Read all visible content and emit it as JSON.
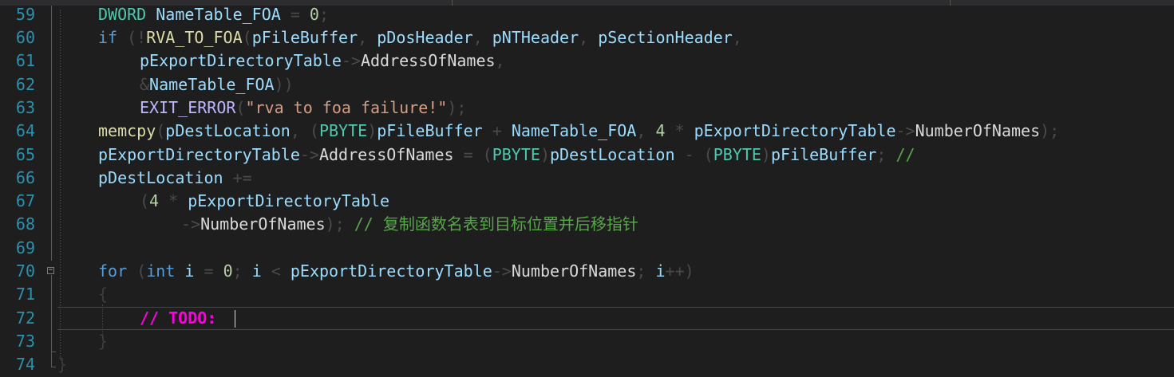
{
  "top_tabs": [
    "",
    "",
    ""
  ],
  "line_numbers": [
    "59",
    "60",
    "61",
    "62",
    "63",
    "64",
    "65",
    "66",
    "67",
    "68",
    "69",
    "70",
    "71",
    "72",
    "73",
    "74"
  ],
  "code": {
    "l59": {
      "t1": "DWORD",
      "t2": " NameTable_FOA",
      "t3": " = ",
      "t4": "0",
      "t5": ";"
    },
    "l60": {
      "t1": "if",
      "t2": " (!",
      "t3": "RVA_TO_FOA",
      "t4": "(",
      "t5": "pFileBuffer",
      "t6": ", ",
      "t7": "pDosHeader",
      "t8": ", ",
      "t9": "pNTHeader",
      "t10": ", ",
      "t11": "pSectionHeader",
      "t12": ","
    },
    "l61": {
      "t1": "pExportDirectoryTable",
      "t2": "->",
      "t3": "AddressOfNames",
      "t4": ","
    },
    "l62": {
      "t1": "&",
      "t2": "NameTable_FOA",
      "t3": "))"
    },
    "l63": {
      "t1": "EXIT_ERROR",
      "t2": "(",
      "t3": "\"rva to foa failure!\"",
      "t4": ");"
    },
    "l64": {
      "t1": "memcpy",
      "t2": "(",
      "t3": "pDestLocation",
      "t4": ", (",
      "t5": "PBYTE",
      "t6": ")",
      "t7": "pFileBuffer",
      "t8": " + ",
      "t9": "NameTable_FOA",
      "t10": ", ",
      "t11": "4",
      "t12": " * ",
      "t13": "pExportDirectoryTable",
      "t14": "->",
      "t15": "NumberOfNames",
      "t16": ");"
    },
    "l65": {
      "t1": "pExportDirectoryTable",
      "t2": "->",
      "t3": "AddressOfNames",
      "t4": " = (",
      "t5": "PBYTE",
      "t6": ")",
      "t7": "pDestLocation",
      "t8": " - (",
      "t9": "PBYTE",
      "t10": ")",
      "t11": "pFileBuffer",
      "t12": "; ",
      "t13": "//"
    },
    "l66": {
      "t1": "pDestLocation",
      "t2": " +="
    },
    "l67": {
      "t1": "(",
      "t2": "4",
      "t3": " * ",
      "t4": "pExportDirectoryTable"
    },
    "l68": {
      "t1": "->",
      "t2": "NumberOfNames",
      "t3": "); ",
      "t4": "// 复制函数名表到目标位置并后移指针"
    },
    "l70": {
      "t1": "for",
      "t2": " (",
      "t3": "int",
      "t4": " i",
      "t5": " = ",
      "t6": "0",
      "t7": "; ",
      "t8": "i",
      "t9": " < ",
      "t10": "pExportDirectoryTable",
      "t11": "->",
      "t12": "NumberOfNames",
      "t13": "; ",
      "t14": "i",
      "t15": "++)"
    },
    "l71": {
      "t1": "{"
    },
    "l72": {
      "t1": "// ",
      "t2": "TODO:"
    },
    "l73": {
      "t1": "}"
    },
    "l74": {
      "t1": "}"
    }
  }
}
